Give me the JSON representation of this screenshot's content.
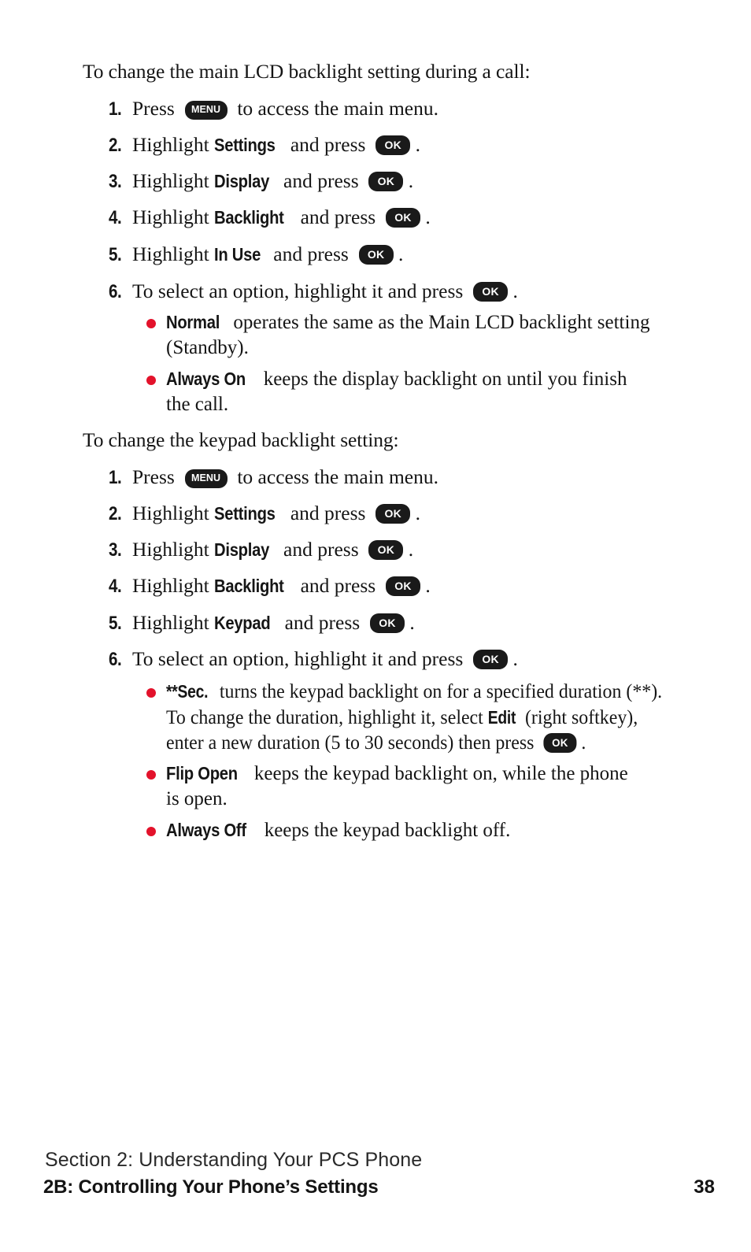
{
  "page": {
    "number": "38"
  },
  "section_one": {
    "intro": "To change the main LCD backlight setting during a call:",
    "steps": [
      {
        "num": "1.",
        "pre": "Press",
        "key": "MENU",
        "post": "to access the main menu."
      },
      {
        "num": "2.",
        "pre": "Highlight",
        "term": "Settings",
        "mid": "and press",
        "key": "OK",
        "post": "."
      },
      {
        "num": "3.",
        "pre": "Highlight",
        "term": "Display",
        "mid": "and press",
        "key": "OK",
        "post": "."
      },
      {
        "num": "4.",
        "pre": "Highlight",
        "term": "Backlight",
        "mid": "and press",
        "key": "OK",
        "post": "."
      },
      {
        "num": "5.",
        "pre": "Highlight",
        "term": "In Use",
        "mid": "and press",
        "key": "OK",
        "post": "."
      },
      {
        "num": "6.",
        "pre": "To select an option, highlight it and press",
        "key": "OK",
        "post": "."
      }
    ],
    "bullets": [
      {
        "term": "Normal",
        "line1": "operates the same as the Main LCD backlight setting",
        "line2": "(Standby)."
      },
      {
        "term": "Always On",
        "line1": "keeps the display backlight on until you finish",
        "line2": "the call."
      }
    ]
  },
  "section_two": {
    "intro": "To change the keypad backlight setting:",
    "steps": [
      {
        "num": "1.",
        "pre": "Press",
        "key": "MENU",
        "post": "to access the main menu."
      },
      {
        "num": "2.",
        "pre": "Highlight",
        "term": "Settings",
        "mid": "and press",
        "key": "OK",
        "post": "."
      },
      {
        "num": "3.",
        "pre": "Highlight",
        "term": "Display",
        "mid": "and press",
        "key": "OK",
        "post": "."
      },
      {
        "num": "4.",
        "pre": "Highlight",
        "term": "Backlight",
        "mid": "and press",
        "key": "OK",
        "post": "."
      },
      {
        "num": "5.",
        "pre": "Highlight",
        "term": "Keypad",
        "mid": "and press",
        "key": "OK",
        "post": "."
      },
      {
        "num": "6.",
        "pre": "To select an option, highlight it and press",
        "key": "OK",
        "post": "."
      }
    ],
    "bullets": [
      {
        "term": "**Sec.",
        "line1": "turns the keypad backlight on for a specified duration (**).",
        "line2_a": "To change the duration, highlight it, select",
        "line2_term": "Edit",
        "line2_b": "(right softkey),",
        "line3_a": "enter a new duration (5 to 30 seconds) then press",
        "line3_key": "OK",
        "line3_b": "."
      },
      {
        "term": "Flip Open",
        "line1": "keeps the keypad backlight on, while the phone",
        "line2": "is open."
      },
      {
        "term": "Always Off",
        "line1": "keeps the keypad backlight off."
      }
    ]
  },
  "footer": {
    "section_line": "Section 2: Understanding Your PCS Phone",
    "chapter_line": "2B: Controlling Your Phone’s Settings",
    "page_number": "38"
  },
  "colors": {
    "bullet_red": "#e3122b",
    "key_pill": "#1a1a1a",
    "text": "#151515"
  }
}
